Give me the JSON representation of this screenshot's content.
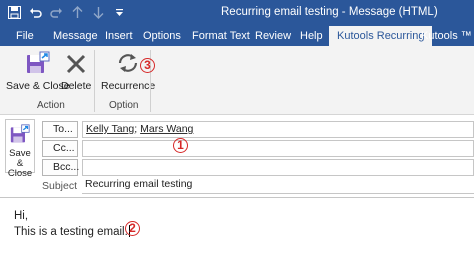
{
  "window": {
    "title": "Recurring email testing  -  Message (HTML)"
  },
  "tabs": [
    {
      "label": "File",
      "active": false
    },
    {
      "label": "Message",
      "active": false
    },
    {
      "label": "Insert",
      "active": false
    },
    {
      "label": "Options",
      "active": false
    },
    {
      "label": "Format Text",
      "active": false
    },
    {
      "label": "Review",
      "active": false
    },
    {
      "label": "Help",
      "active": false
    },
    {
      "label": "Kutools Recurring",
      "active": true
    },
    {
      "label": "Kutools ™",
      "active": false
    }
  ],
  "ribbon": {
    "save_close_label": "Save & Close",
    "delete_label": "Delete",
    "recurrence_label": "Recurrence",
    "group_action": "Action",
    "group_option": "Option"
  },
  "header": {
    "send_label_line1": "Save &",
    "send_label_line2": "Close",
    "to_label": "To...",
    "cc_label": "Cc...",
    "bcc_label": "Bcc...",
    "to_recipients": [
      "Kelly Tang",
      "Mars Wang"
    ],
    "recipient_separator": "; ",
    "cc_value": "",
    "bcc_value": "",
    "subject_label": "Subject",
    "subject_value": "Recurring email testing"
  },
  "body": {
    "line1": "Hi,",
    "line2": "This is a testing email."
  },
  "annotations": {
    "badge1": "1",
    "badge2": "2",
    "badge3": "3"
  },
  "colors": {
    "accent": "#2b579a",
    "badge": "#d62828",
    "ribbon_bg": "#f3f3f3"
  },
  "icons": [
    "save-icon",
    "undo-icon",
    "redo-icon",
    "up-arrow-icon",
    "down-arrow-icon",
    "customize-qat-icon",
    "save-close-icon",
    "delete-icon",
    "recurrence-icon"
  ]
}
